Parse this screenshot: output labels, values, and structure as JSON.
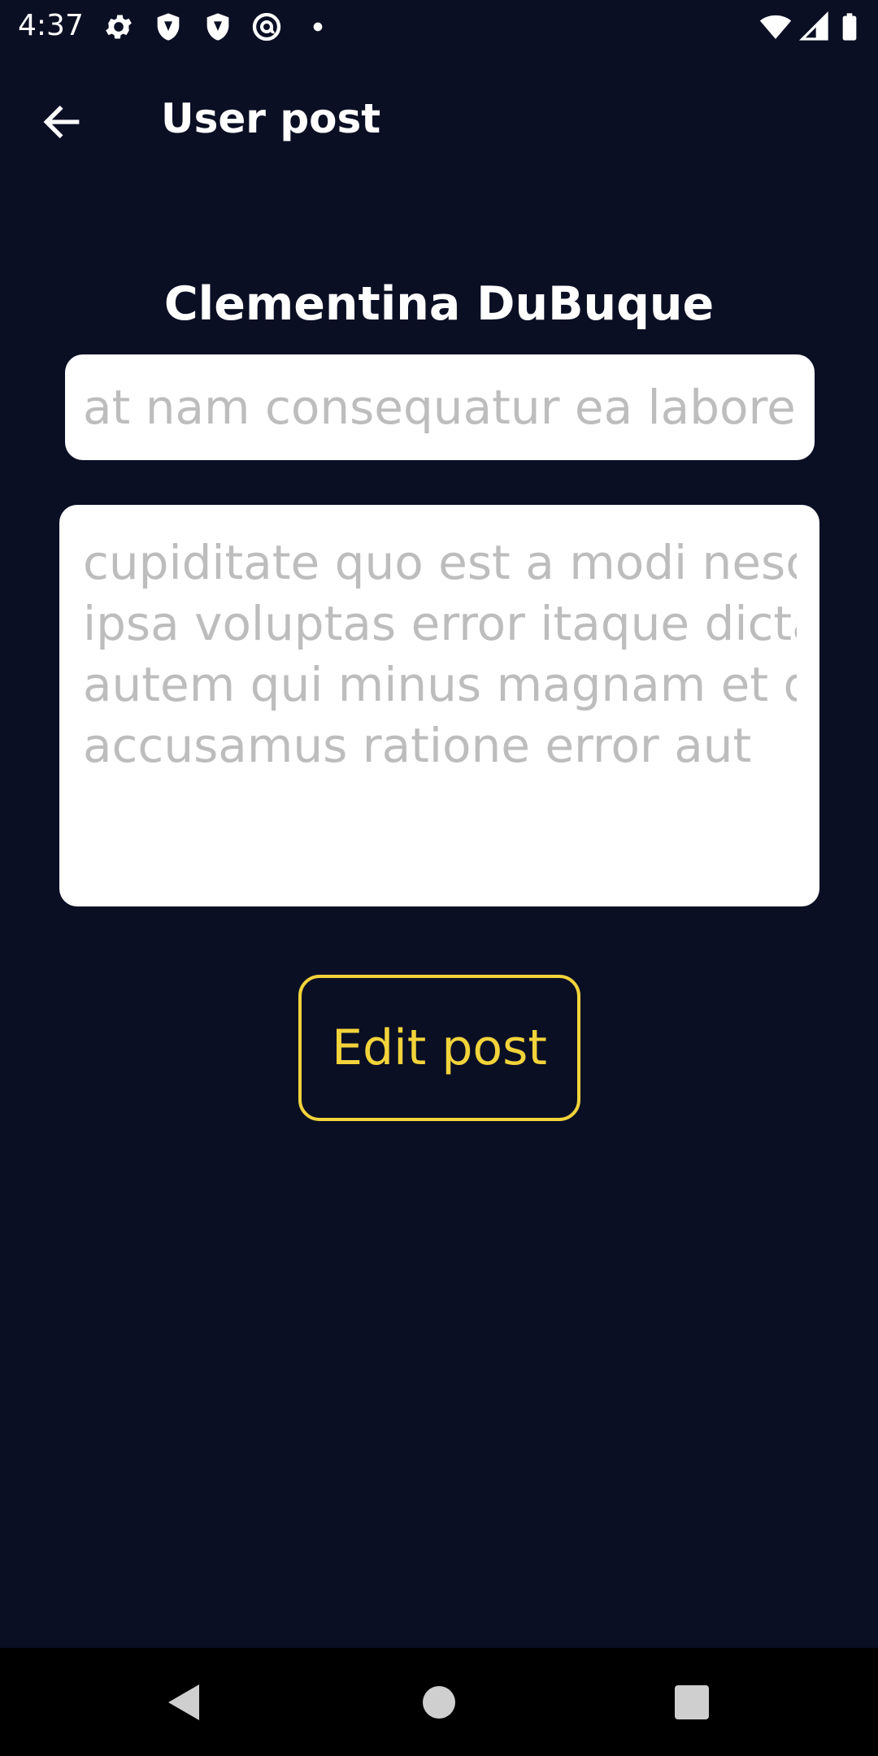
{
  "status_bar": {
    "time": "4:37",
    "left_icons": [
      "settings-icon",
      "shield-icon",
      "shield-icon",
      "at-sign-icon",
      "dot-icon"
    ],
    "right_icons": [
      "wifi-icon",
      "cellular-signal-icon",
      "battery-icon"
    ]
  },
  "app_bar": {
    "back_icon": "arrow-left-icon",
    "title": "User post"
  },
  "post": {
    "author": "Clementina DuBuque",
    "title_value": "at nam consequatur ea labore ea harum",
    "body_lines": [
      "cupiditate quo est a modi nesciunt soluta",
      "ipsa voluptas error itaque dicta in",
      "autem qui minus magnam et distinctio eum",
      "accusamus ratione error aut"
    ]
  },
  "actions": {
    "edit_label": "Edit post"
  },
  "nav_bar": {
    "buttons": [
      "back-triangle-icon",
      "home-circle-icon",
      "recents-square-icon"
    ]
  },
  "colors": {
    "background": "#0b0f24",
    "accent": "#f2d33a",
    "field_background": "#ffffff",
    "field_text": "#bdbdbd",
    "text_primary": "#ffffff",
    "nav_background": "#000000"
  }
}
